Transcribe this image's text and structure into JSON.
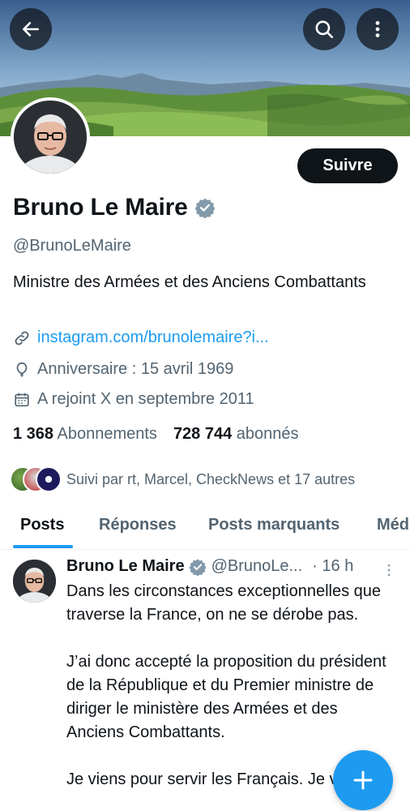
{
  "header": {
    "back_icon": "arrow-left-icon",
    "search_icon": "search-icon",
    "more_icon": "more-vertical-icon"
  },
  "profile": {
    "name": "Bruno Le Maire",
    "handle": "@BrunoLeMaire",
    "bio": "Ministre des Armées et des Anciens Combattants",
    "follow_label": "Suivre",
    "link": "instagram.com/brunolemaire?i...",
    "birthday": "Anniversaire : 15 avril 1969",
    "joined": "A rejoint X en septembre 2011",
    "following_count": "1 368",
    "following_label": "Abonnements",
    "followers_count": "728 744",
    "followers_label": "abonnés",
    "followed_by": "Suivi par rt, Marcel, CheckNews et 17 autres"
  },
  "tabs": [
    {
      "label": "Posts",
      "active": true
    },
    {
      "label": "Réponses",
      "active": false
    },
    {
      "label": "Posts marquants",
      "active": false
    },
    {
      "label": "Méd",
      "active": false
    }
  ],
  "post": {
    "author": "Bruno Le Maire",
    "handle": "@BrunoLe...",
    "time": "· 16 h",
    "paragraphs": [
      "Dans les circonstances exceptionnelles que traverse la France, on ne se dérobe pas.",
      "J’ai donc accepté la proposition du président de la République et du Premier ministre de diriger le ministère des Armées et des Anciens Combattants.",
      "Je viens pour servir les Français. Je vous"
    ]
  },
  "colors": {
    "accent": "#1d9bf0",
    "text": "#0f1419",
    "secondary": "#536471"
  }
}
